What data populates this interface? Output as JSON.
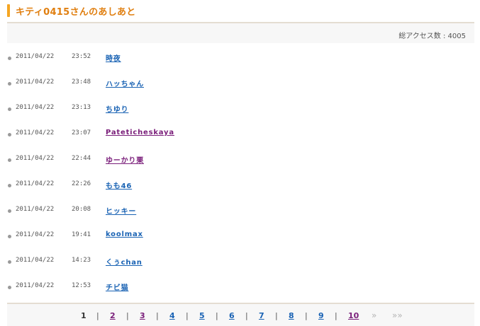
{
  "header": {
    "title": "キティ0415さんのあしあと"
  },
  "access": {
    "label": "総アクセス数 : 4005"
  },
  "visits": [
    {
      "date": "2011/04/22",
      "time": "23:52",
      "name": "時夜",
      "color": "blue"
    },
    {
      "date": "2011/04/22",
      "time": "23:48",
      "name": "ハッちゃん",
      "color": "blue"
    },
    {
      "date": "2011/04/22",
      "time": "23:13",
      "name": "ちゆり",
      "color": "blue"
    },
    {
      "date": "2011/04/22",
      "time": "23:07",
      "name": "Pateticheskaya",
      "color": "purple"
    },
    {
      "date": "2011/04/22",
      "time": "22:44",
      "name": "ゆーかり栗",
      "color": "purple"
    },
    {
      "date": "2011/04/22",
      "time": "22:26",
      "name": "もも46",
      "color": "blue"
    },
    {
      "date": "2011/04/22",
      "time": "20:08",
      "name": "ヒッキー",
      "color": "blue"
    },
    {
      "date": "2011/04/22",
      "time": "19:41",
      "name": "koolmax",
      "color": "blue"
    },
    {
      "date": "2011/04/22",
      "time": "14:23",
      "name": "くぅchan",
      "color": "blue"
    },
    {
      "date": "2011/04/22",
      "time": "12:53",
      "name": "チビ猫",
      "color": "blue"
    }
  ],
  "pagination": {
    "pages": [
      {
        "label": "1",
        "state": "current"
      },
      {
        "label": "2",
        "state": "visited"
      },
      {
        "label": "3",
        "state": "visited"
      },
      {
        "label": "4",
        "state": "link"
      },
      {
        "label": "5",
        "state": "link"
      },
      {
        "label": "6",
        "state": "link"
      },
      {
        "label": "7",
        "state": "link"
      },
      {
        "label": "8",
        "state": "link"
      },
      {
        "label": "9",
        "state": "link"
      },
      {
        "label": "10",
        "state": "visited"
      }
    ],
    "separator": "|",
    "next_label": "»",
    "last_label": "»»"
  },
  "colors": {
    "accent": "#f5a623",
    "title": "#e07f10",
    "link": "#1a63b4",
    "visited": "#7a1e7a"
  }
}
